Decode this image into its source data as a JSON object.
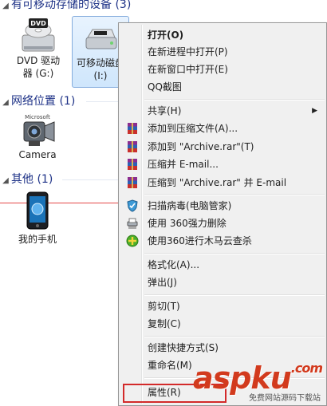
{
  "sections": {
    "removable": {
      "title": "有可移动存储的设备 (3)"
    },
    "network": {
      "title": "网络位置 (1)"
    },
    "other": {
      "title": "其他 (1)"
    }
  },
  "devices": {
    "dvd": {
      "label": "DVD 驱动器 (G:)",
      "badge": "DVD"
    },
    "removable": {
      "label": "可移动磁盘 (I:)"
    },
    "camera": {
      "label": "Camera",
      "brand": "Microsoft"
    },
    "phone": {
      "label": "我的手机"
    }
  },
  "context_menu": {
    "items": [
      {
        "label": "打开(O)",
        "bold": true
      },
      {
        "label": "在新进程中打开(P)"
      },
      {
        "label": "在新窗口中打开(E)"
      },
      {
        "label": "QQ截图"
      },
      {
        "label": "共享(H)",
        "submenu": true
      },
      {
        "label": "添加到压缩文件(A)...",
        "icon": "winrar-icon"
      },
      {
        "label": "添加到 \"Archive.rar\"(T)",
        "icon": "winrar-icon"
      },
      {
        "label": "压缩并 E-mail...",
        "icon": "winrar-icon"
      },
      {
        "label": "压缩到 \"Archive.rar\" 并 E-mail",
        "icon": "winrar-icon"
      },
      {
        "label": "扫描病毒(电脑管家)",
        "icon": "shield-icon"
      },
      {
        "label": "使用 360强力删除",
        "icon": "shredder-icon"
      },
      {
        "label": "使用360进行木马云查杀",
        "icon": "360-icon"
      },
      {
        "label": "格式化(A)..."
      },
      {
        "label": "弹出(J)"
      },
      {
        "label": "剪切(T)"
      },
      {
        "label": "复制(C)"
      },
      {
        "label": "创建快捷方式(S)"
      },
      {
        "label": "重命名(M)"
      },
      {
        "label": "属性(R)"
      }
    ]
  },
  "watermark": {
    "logo": "aspku",
    "tld": ".com",
    "subtitle": "免费网站源码下载站"
  },
  "colors": {
    "header_text": "#1e3287",
    "menu_bg": "#f0f0f0",
    "highlight_red": "#d32a2a",
    "watermark_red": "#d23a1d"
  }
}
